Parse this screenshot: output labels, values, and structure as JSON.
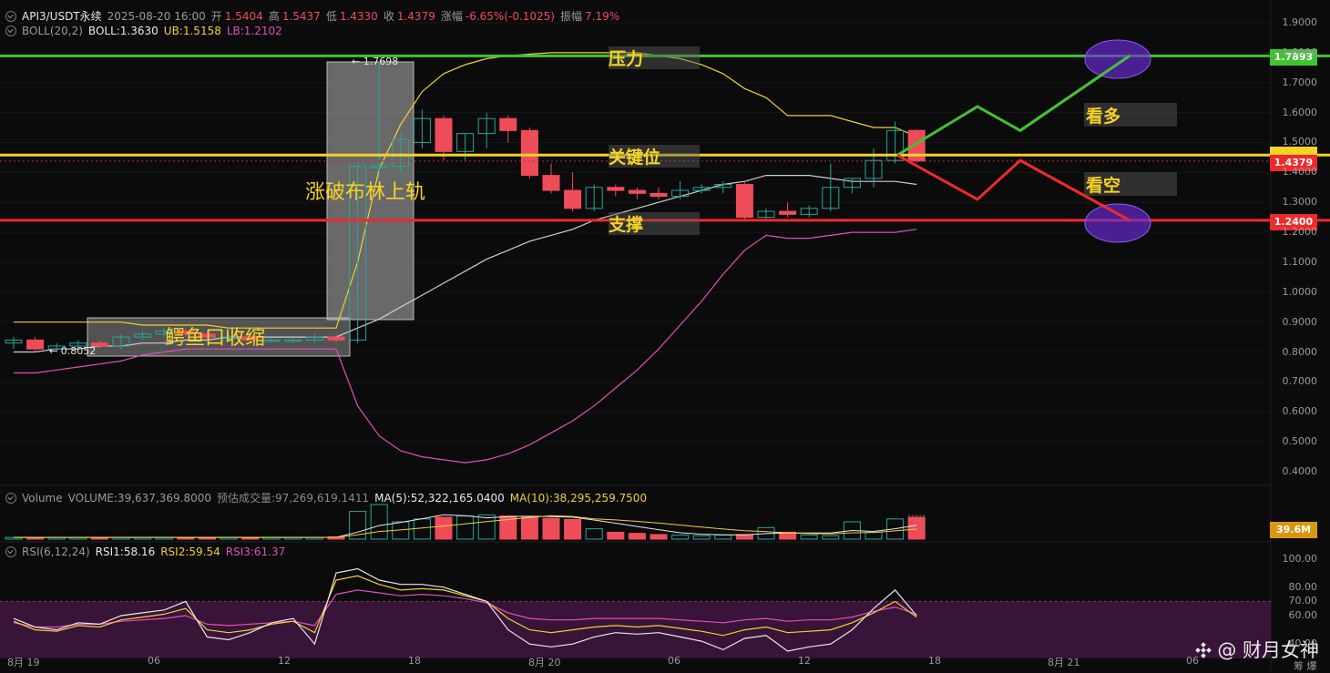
{
  "header": {
    "symbol": "API3/USDT永续",
    "datetime": "2025-08-20 16:00",
    "open_label": "开",
    "open": "1.5404",
    "high_label": "高",
    "high": "1.5437",
    "low_label": "低",
    "low": "1.4330",
    "close_label": "收",
    "close": "1.4379",
    "change_label": "涨幅",
    "change": "-6.65%(-0.1025)",
    "amp_label": "振幅",
    "amp": "7.19%"
  },
  "boll": {
    "name": "BOLL(20,2)",
    "boll": "BOLL:1.3630",
    "ub": "UB:1.5158",
    "lb": "LB:1.2102"
  },
  "volume": {
    "name": "Volume",
    "value": "VOLUME:39,637,369.8000",
    "est": "预估成交量:97,269,619.1411",
    "ma5": "MA(5):52,322,165.0400",
    "ma10": "MA(10):38,295,259.7500",
    "tag": "39.6M"
  },
  "rsi": {
    "name": "RSI(6,12,24)",
    "rsi1": "RSI1:58.16",
    "rsi2": "RSI2:59.54",
    "rsi3": "RSI3:61.37"
  },
  "annotations": {
    "pressure": "压力",
    "key": "关键位",
    "support": "支撑",
    "bull": "看多",
    "bear": "看空",
    "breakout": "涨破布林上轨",
    "squeeze": "鳄鱼口收缩",
    "high_marker": "← 1.7698",
    "low_marker": "← 0.8052"
  },
  "price_tags": {
    "pressure": "1.7893",
    "key": "1.4379",
    "support": "1.2400"
  },
  "x_labels": [
    "8月 19",
    "06",
    "12",
    "18",
    "8月 20",
    "06",
    "12",
    "18",
    "8月 21",
    "06"
  ],
  "corner_text": "筹 爆",
  "watermark": "@ 财月女神",
  "colors": {
    "up": "#26a69a",
    "down": "#ef4c5a",
    "pressure": "#42c232",
    "key": "#f5d327",
    "support": "#ef2a2a",
    "ub": "#f0d133",
    "mid": "#cfcfcf",
    "lb": "#e14fbd",
    "ellipse": "#6c2bd9"
  },
  "chart_data": {
    "type": "candlestick",
    "price_axis": {
      "ticks": [
        1.9,
        1.8,
        1.7,
        1.6,
        1.5,
        1.4,
        1.3,
        1.2,
        1.1,
        1.0,
        0.9,
        0.8,
        0.7,
        0.6,
        0.5,
        0.4
      ],
      "min": 0.34,
      "max": 1.94
    },
    "candles": [
      {
        "o": 0.83,
        "h": 0.85,
        "l": 0.81,
        "c": 0.84
      },
      {
        "o": 0.84,
        "h": 0.85,
        "l": 0.8,
        "c": 0.81
      },
      {
        "o": 0.81,
        "h": 0.83,
        "l": 0.8,
        "c": 0.82
      },
      {
        "o": 0.82,
        "h": 0.84,
        "l": 0.81,
        "c": 0.83
      },
      {
        "o": 0.83,
        "h": 0.84,
        "l": 0.81,
        "c": 0.82
      },
      {
        "o": 0.82,
        "h": 0.86,
        "l": 0.81,
        "c": 0.85
      },
      {
        "o": 0.85,
        "h": 0.87,
        "l": 0.84,
        "c": 0.86
      },
      {
        "o": 0.86,
        "h": 0.88,
        "l": 0.85,
        "c": 0.87
      },
      {
        "o": 0.87,
        "h": 0.88,
        "l": 0.85,
        "c": 0.86
      },
      {
        "o": 0.86,
        "h": 0.87,
        "l": 0.84,
        "c": 0.85
      },
      {
        "o": 0.85,
        "h": 0.86,
        "l": 0.84,
        "c": 0.85
      },
      {
        "o": 0.85,
        "h": 0.86,
        "l": 0.83,
        "c": 0.84
      },
      {
        "o": 0.84,
        "h": 0.85,
        "l": 0.83,
        "c": 0.84
      },
      {
        "o": 0.84,
        "h": 0.85,
        "l": 0.83,
        "c": 0.84
      },
      {
        "o": 0.84,
        "h": 0.86,
        "l": 0.83,
        "c": 0.85
      },
      {
        "o": 0.85,
        "h": 0.86,
        "l": 0.83,
        "c": 0.84
      },
      {
        "o": 0.84,
        "h": 1.43,
        "l": 0.83,
        "c": 1.42
      },
      {
        "o": 1.42,
        "h": 1.77,
        "l": 1.38,
        "c": 1.42
      },
      {
        "o": 1.42,
        "h": 1.53,
        "l": 1.4,
        "c": 1.51
      },
      {
        "o": 1.5,
        "h": 1.61,
        "l": 1.48,
        "c": 1.58
      },
      {
        "o": 1.58,
        "h": 1.59,
        "l": 1.44,
        "c": 1.47
      },
      {
        "o": 1.47,
        "h": 1.53,
        "l": 1.44,
        "c": 1.53
      },
      {
        "o": 1.53,
        "h": 1.6,
        "l": 1.48,
        "c": 1.58
      },
      {
        "o": 1.58,
        "h": 1.59,
        "l": 1.5,
        "c": 1.54
      },
      {
        "o": 1.54,
        "h": 1.55,
        "l": 1.38,
        "c": 1.39
      },
      {
        "o": 1.39,
        "h": 1.43,
        "l": 1.33,
        "c": 1.34
      },
      {
        "o": 1.34,
        "h": 1.4,
        "l": 1.27,
        "c": 1.28
      },
      {
        "o": 1.28,
        "h": 1.36,
        "l": 1.27,
        "c": 1.35
      },
      {
        "o": 1.35,
        "h": 1.36,
        "l": 1.32,
        "c": 1.34
      },
      {
        "o": 1.34,
        "h": 1.35,
        "l": 1.31,
        "c": 1.33
      },
      {
        "o": 1.33,
        "h": 1.35,
        "l": 1.31,
        "c": 1.32
      },
      {
        "o": 1.32,
        "h": 1.37,
        "l": 1.31,
        "c": 1.34
      },
      {
        "o": 1.34,
        "h": 1.36,
        "l": 1.33,
        "c": 1.35
      },
      {
        "o": 1.35,
        "h": 1.37,
        "l": 1.33,
        "c": 1.36
      },
      {
        "o": 1.36,
        "h": 1.37,
        "l": 1.24,
        "c": 1.25
      },
      {
        "o": 1.25,
        "h": 1.28,
        "l": 1.24,
        "c": 1.27
      },
      {
        "o": 1.27,
        "h": 1.3,
        "l": 1.25,
        "c": 1.26
      },
      {
        "o": 1.26,
        "h": 1.29,
        "l": 1.25,
        "c": 1.28
      },
      {
        "o": 1.28,
        "h": 1.43,
        "l": 1.27,
        "c": 1.35
      },
      {
        "o": 1.35,
        "h": 1.38,
        "l": 1.33,
        "c": 1.38
      },
      {
        "o": 1.38,
        "h": 1.48,
        "l": 1.35,
        "c": 1.44
      },
      {
        "o": 1.44,
        "h": 1.57,
        "l": 1.43,
        "c": 1.54
      },
      {
        "o": 1.5404,
        "h": 1.5437,
        "l": 1.433,
        "c": 1.4379
      }
    ],
    "boll_upper": [
      0.9,
      0.9,
      0.9,
      0.9,
      0.9,
      0.9,
      0.89,
      0.89,
      0.89,
      0.89,
      0.88,
      0.88,
      0.88,
      0.88,
      0.88,
      0.88,
      1.1,
      1.41,
      1.56,
      1.67,
      1.73,
      1.76,
      1.78,
      1.79,
      1.795,
      1.8,
      1.8,
      1.8,
      1.8,
      1.8,
      1.79,
      1.78,
      1.76,
      1.73,
      1.68,
      1.65,
      1.59,
      1.59,
      1.59,
      1.57,
      1.55,
      1.55,
      1.52
    ],
    "boll_mid": [
      0.8,
      0.8,
      0.81,
      0.81,
      0.82,
      0.82,
      0.83,
      0.83,
      0.84,
      0.84,
      0.85,
      0.85,
      0.85,
      0.85,
      0.85,
      0.85,
      0.88,
      0.91,
      0.95,
      0.99,
      1.03,
      1.07,
      1.11,
      1.14,
      1.17,
      1.19,
      1.21,
      1.24,
      1.26,
      1.28,
      1.3,
      1.32,
      1.34,
      1.36,
      1.37,
      1.39,
      1.39,
      1.39,
      1.38,
      1.37,
      1.37,
      1.37,
      1.36
    ],
    "boll_lower": [
      0.73,
      0.73,
      0.74,
      0.75,
      0.76,
      0.77,
      0.79,
      0.8,
      0.81,
      0.81,
      0.81,
      0.81,
      0.81,
      0.81,
      0.81,
      0.81,
      0.62,
      0.52,
      0.47,
      0.45,
      0.44,
      0.43,
      0.44,
      0.46,
      0.49,
      0.53,
      0.57,
      0.62,
      0.68,
      0.74,
      0.81,
      0.89,
      0.97,
      1.06,
      1.14,
      1.19,
      1.18,
      1.18,
      1.19,
      1.2,
      1.2,
      1.2,
      1.21
    ],
    "volume_bars": [
      3,
      3,
      3,
      3,
      3,
      3,
      3,
      3,
      3,
      3,
      3,
      3,
      3,
      3,
      3,
      4,
      48,
      60,
      30,
      35,
      38,
      40,
      42,
      40,
      38,
      36,
      34,
      18,
      12,
      10,
      8,
      7,
      6,
      7,
      8,
      20,
      12,
      7,
      6,
      30,
      12,
      35,
      38,
      18
    ],
    "rsi1": [
      58,
      52,
      50,
      55,
      54,
      60,
      62,
      64,
      70,
      45,
      43,
      48,
      55,
      58,
      40,
      90,
      93,
      85,
      82,
      82,
      80,
      75,
      70,
      50,
      40,
      38,
      40,
      45,
      48,
      47,
      48,
      45,
      42,
      36,
      44,
      46,
      35,
      38,
      40,
      50,
      65,
      78,
      60
    ],
    "rsi2": [
      56,
      50,
      49,
      53,
      52,
      57,
      59,
      61,
      65,
      50,
      48,
      50,
      54,
      56,
      48,
      85,
      88,
      82,
      78,
      79,
      78,
      74,
      70,
      58,
      50,
      48,
      50,
      52,
      53,
      52,
      53,
      51,
      49,
      46,
      50,
      52,
      48,
      49,
      50,
      55,
      62,
      70,
      59
    ],
    "rsi3": [
      55,
      52,
      52,
      54,
      54,
      56,
      57,
      58,
      60,
      54,
      53,
      54,
      55,
      56,
      53,
      75,
      78,
      76,
      74,
      75,
      74,
      72,
      69,
      62,
      58,
      57,
      57,
      58,
      58,
      58,
      58,
      57,
      56,
      55,
      57,
      58,
      56,
      57,
      57,
      59,
      63,
      66,
      61
    ],
    "levels": {
      "pressure": 1.7893,
      "key": 1.4579,
      "support": 1.24
    },
    "scenario_bull": [
      1.4579,
      1.62,
      1.54,
      1.79
    ],
    "scenario_bear": [
      1.4579,
      1.31,
      1.44,
      1.24
    ]
  }
}
